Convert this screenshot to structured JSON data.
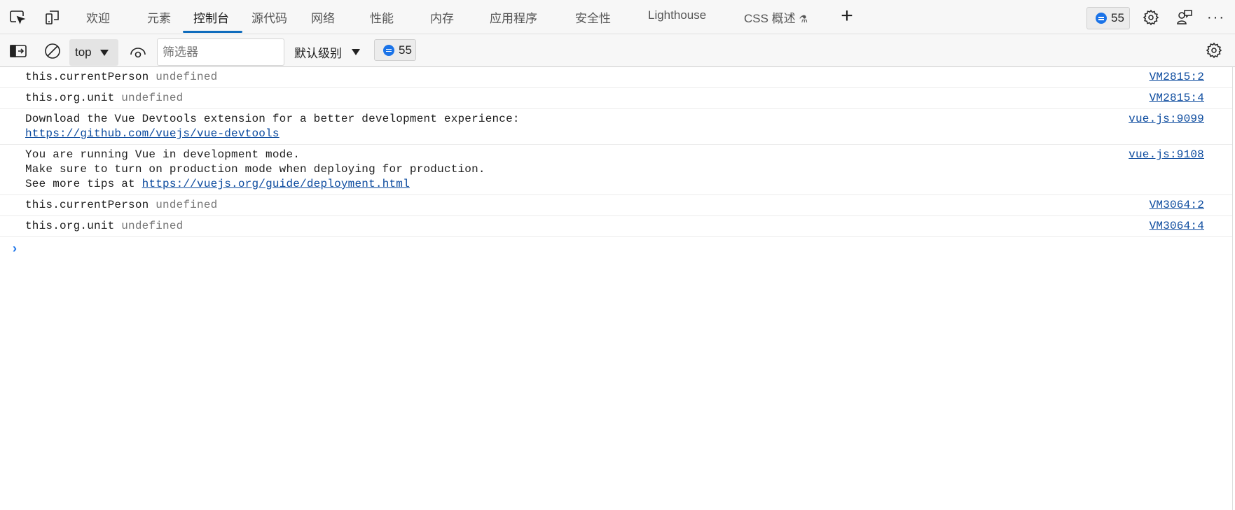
{
  "tabs": [
    "欢迎",
    "元素",
    "控制台",
    "源代码",
    "网络",
    "性能",
    "内存",
    "应用程序",
    "安全性",
    "Lighthouse",
    "CSS 概述"
  ],
  "active_tab": "控制台",
  "issues_count": "55",
  "toolbar": {
    "context": "top",
    "filter_placeholder": "筛选器",
    "level": "默认级别",
    "messages_count": "55"
  },
  "logs": [
    {
      "parts": [
        {
          "t": "this.currentPerson "
        },
        {
          "t": "undefined",
          "c": "undef"
        }
      ],
      "source": "VM2815:2"
    },
    {
      "parts": [
        {
          "t": "this.org.unit "
        },
        {
          "t": "undefined",
          "c": "undef"
        }
      ],
      "source": "VM2815:4"
    },
    {
      "parts": [
        {
          "t": "Download the Vue Devtools extension for a better development experience:\n"
        },
        {
          "t": "https://github.com/vuejs/vue-devtools",
          "c": "lnk"
        }
      ],
      "source": "vue.js:9099"
    },
    {
      "parts": [
        {
          "t": "You are running Vue in development mode.\nMake sure to turn on production mode when deploying for production.\nSee more tips at "
        },
        {
          "t": "https://vuejs.org/guide/deployment.html",
          "c": "lnk"
        }
      ],
      "source": "vue.js:9108"
    },
    {
      "parts": [
        {
          "t": "this.currentPerson "
        },
        {
          "t": "undefined",
          "c": "undef"
        }
      ],
      "source": "VM3064:2"
    },
    {
      "parts": [
        {
          "t": "this.org.unit "
        },
        {
          "t": "undefined",
          "c": "undef"
        }
      ],
      "source": "VM3064:4"
    }
  ],
  "colors": {
    "accent": "#0f6cbd",
    "link": "#0b4a9e",
    "badge": "#1a73e8"
  }
}
